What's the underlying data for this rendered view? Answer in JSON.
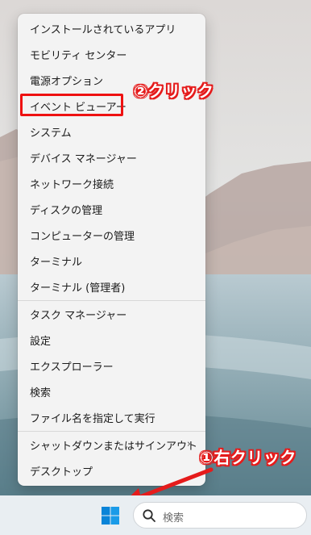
{
  "menu": {
    "items": [
      {
        "label": "インストールされているアプリ"
      },
      {
        "label": "モビリティ センター"
      },
      {
        "label": "電源オプション"
      },
      {
        "label": "イベント ビューアー"
      },
      {
        "label": "システム"
      },
      {
        "label": "デバイス マネージャー"
      },
      {
        "label": "ネットワーク接続"
      },
      {
        "label": "ディスクの管理"
      },
      {
        "label": "コンピューターの管理"
      },
      {
        "label": "ターミナル"
      },
      {
        "label": "ターミナル (管理者)"
      },
      {
        "label": "タスク マネージャー"
      },
      {
        "label": "設定"
      },
      {
        "label": "エクスプローラー"
      },
      {
        "label": "検索"
      },
      {
        "label": "ファイル名を指定して実行"
      },
      {
        "label": "シャットダウンまたはサインアウト",
        "submenu": "›"
      },
      {
        "label": "デスクトップ"
      }
    ]
  },
  "annotations": {
    "step2": "②クリック",
    "step1": "①右クリック"
  },
  "taskbar": {
    "search_placeholder": "検索"
  },
  "colors": {
    "highlight": "#e51b1b",
    "start_icon": "#0a84d8"
  }
}
